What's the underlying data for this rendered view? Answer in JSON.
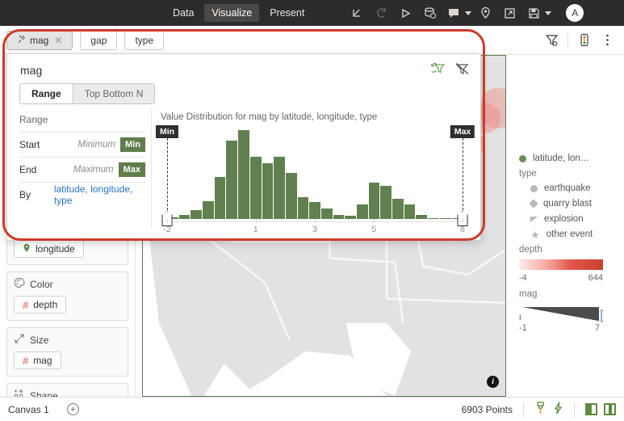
{
  "topbar": {
    "nav": [
      {
        "label": "Data",
        "active": false
      },
      {
        "label": "Visualize",
        "active": true
      },
      {
        "label": "Present",
        "active": false
      }
    ],
    "icons": [
      {
        "name": "undo-icon"
      },
      {
        "name": "redo-icon"
      },
      {
        "name": "play-icon"
      },
      {
        "name": "database-refresh-icon"
      },
      {
        "name": "comment-icon"
      },
      {
        "name": "location-pin-icon"
      },
      {
        "name": "export-icon"
      },
      {
        "name": "save-icon"
      }
    ],
    "avatar_initial": "A"
  },
  "tabstrip": {
    "chips": [
      {
        "label": "mag",
        "selected": true,
        "closable": true
      },
      {
        "label": "gap",
        "selected": false,
        "closable": false
      },
      {
        "label": "type",
        "selected": false,
        "closable": false
      }
    ],
    "right_icons": [
      {
        "name": "filter-funnel-icon"
      },
      {
        "name": "traffic-light-icon"
      },
      {
        "name": "more-vertical-icon"
      }
    ]
  },
  "sidebar": {
    "shelves": [
      {
        "title": "",
        "icon": "location-pin-icon",
        "field": "longitude",
        "field_icon": "location-pin-icon"
      },
      {
        "title": "Color",
        "icon": "palette-icon",
        "field": "depth",
        "field_icon": "hash-icon"
      },
      {
        "title": "Size",
        "icon": "resize-icon",
        "field": "mag",
        "field_icon": "hash-icon"
      },
      {
        "title": "Shape",
        "icon": "shapes-icon",
        "field": "",
        "field_icon": ""
      }
    ]
  },
  "filter_popup": {
    "title": "mag",
    "header_icons": [
      {
        "name": "reset-filter-icon"
      },
      {
        "name": "disable-filter-icon"
      }
    ],
    "segments": [
      {
        "label": "Range",
        "active": true
      },
      {
        "label": "Top Bottom N",
        "active": false
      }
    ],
    "range_label": "Range",
    "rows": [
      {
        "key": "Start",
        "value": "Minimum",
        "button": "Min"
      },
      {
        "key": "End",
        "value": "Maximum",
        "button": "Max"
      }
    ],
    "by_label": "By",
    "by_value": "latitude, longitude, type",
    "min_tag": "Min",
    "max_tag": "Max"
  },
  "chart_data": {
    "type": "bar",
    "title": "Value Distribution for mag by latitude, longitude, type",
    "xlabel": "",
    "ylabel": "",
    "xlim": [
      -2,
      8
    ],
    "ylim": [
      0,
      100
    ],
    "grid": false,
    "legend": "none",
    "tick_values": [
      -2,
      1,
      3,
      5,
      8
    ],
    "tick_labels": [
      "-2",
      "1",
      "3",
      "5",
      "8"
    ],
    "bin_width": 0.25,
    "x": [
      -0.75,
      -0.5,
      -0.25,
      0.0,
      0.25,
      0.5,
      0.75,
      1.0,
      1.25,
      1.5,
      1.75,
      2.0,
      2.25,
      2.5,
      2.75,
      3.0,
      3.25,
      3.5,
      3.75,
      4.0,
      4.25,
      4.5,
      4.75,
      5.0,
      5.25
    ],
    "values": [
      2,
      5,
      10,
      20,
      47,
      88,
      100,
      70,
      63,
      70,
      52,
      25,
      19,
      12,
      5,
      4,
      16,
      41,
      37,
      23,
      16,
      5,
      0,
      0,
      0
    ],
    "bar_color": "#61804f",
    "selection": {
      "min": -2,
      "max": 8
    }
  },
  "legend": {
    "series_label": "latitude, lon…",
    "groups": [
      {
        "title": "type",
        "items": [
          {
            "label": "earthquake",
            "symbol": "circle"
          },
          {
            "label": "quarry blast",
            "symbol": "diamond"
          },
          {
            "label": "explosion",
            "symbol": "triangle"
          },
          {
            "label": "other event",
            "symbol": "star"
          }
        ]
      }
    ],
    "depth": {
      "title": "depth",
      "min": "-4",
      "max": "644"
    },
    "mag": {
      "title": "mag",
      "min": "-1",
      "max": "7"
    }
  },
  "map": {
    "info_icon": "info-icon"
  },
  "statusbar": {
    "canvas_label": "Canvas 1",
    "add_button": "+",
    "points_label": "6903 Points",
    "icons": [
      {
        "name": "brush-icon"
      },
      {
        "name": "lightning-icon"
      },
      {
        "name": "panel-left-icon"
      },
      {
        "name": "panel-both-icon"
      }
    ]
  },
  "colors": {
    "accent_green": "#5f7d4a",
    "bar_green": "#61804f",
    "highlight_red": "#cf3a28",
    "bubble_red": "#f08b86",
    "link_blue": "#2a74c4"
  }
}
